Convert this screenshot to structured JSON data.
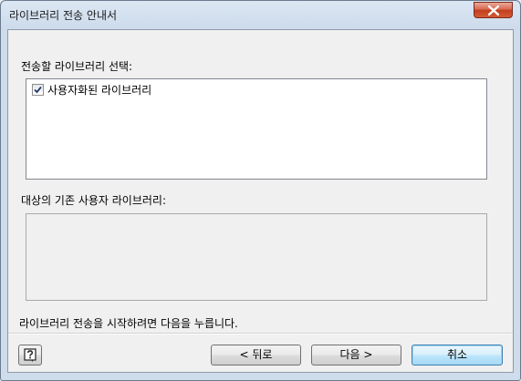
{
  "window": {
    "title": "라이브러리 전송 안내서"
  },
  "source": {
    "label": "전송할 라이브러리 선택:",
    "items": [
      {
        "label": "사용자화된 라이브러리",
        "checked": true
      }
    ]
  },
  "target": {
    "label": "대상의 기존 사용자 라이브러리:",
    "items": []
  },
  "instruction": "라이브러리 전송을 시작하려면 다음을 누릅니다.",
  "buttons": {
    "back": "< 뒤로",
    "next": "다음 >",
    "cancel": "취소"
  },
  "icons": {
    "close": "close-icon",
    "help": "help-icon",
    "check": "checkmark-icon"
  }
}
